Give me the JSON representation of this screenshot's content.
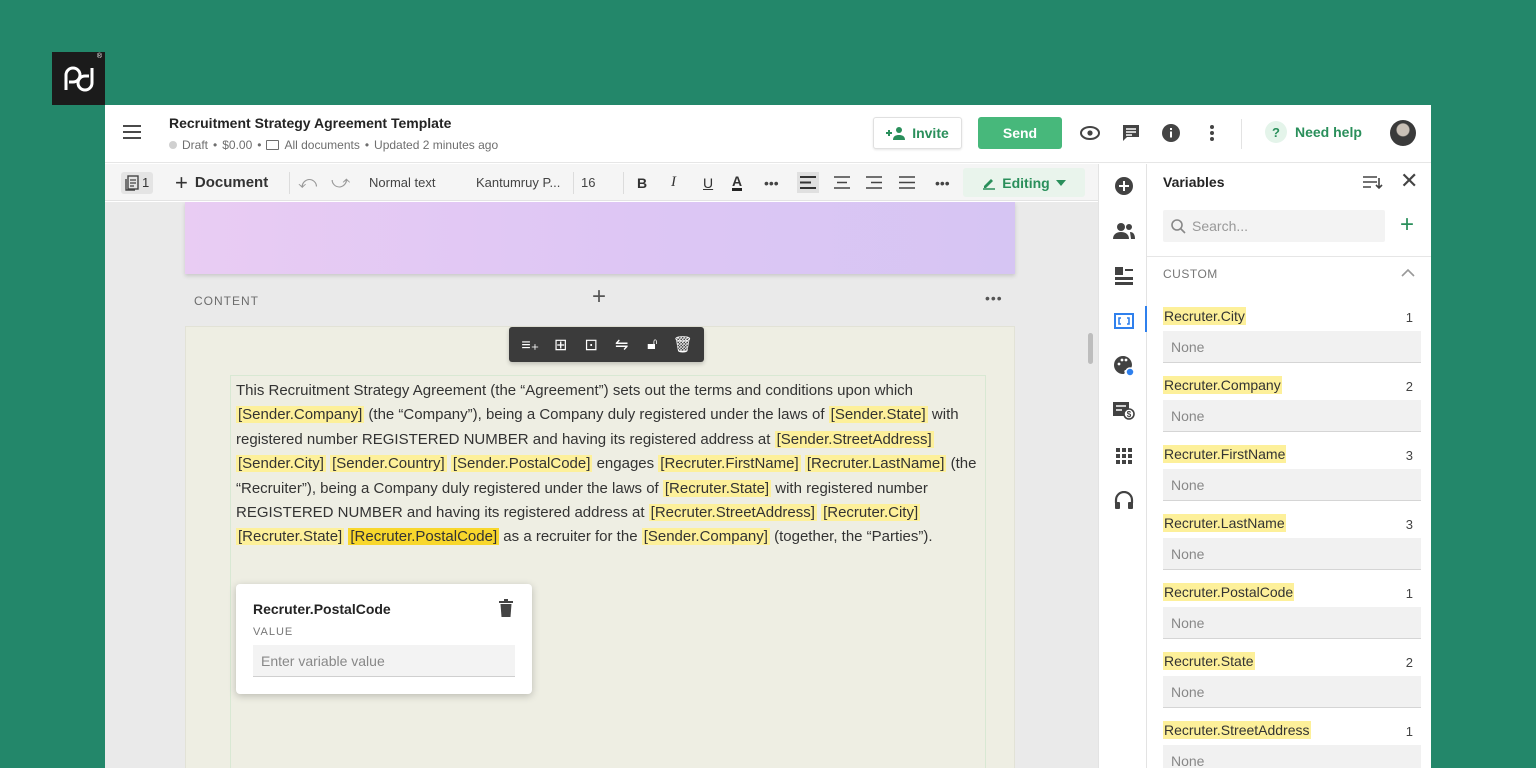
{
  "document": {
    "title": "Recruitment Strategy Agreement Template",
    "status": "Draft",
    "price": "$0.00",
    "folder": "All documents",
    "updated": "Updated 2 minutes ago"
  },
  "header": {
    "invite_label": "Invite",
    "send_label": "Send",
    "help_label": "Need help"
  },
  "toolbar": {
    "pages_count": "1",
    "add_document_label": "Document",
    "text_style": "Normal text",
    "font_name": "Kantumruy P...",
    "font_size": "16",
    "editing_label": "Editing"
  },
  "content": {
    "section_label": "CONTENT",
    "paragraph": [
      {
        "t": "This Recruitment Strategy Agreement (the “Agreement”) sets out the terms and conditions upon which ",
        "v": false
      },
      {
        "t": "[Sender.Company]",
        "v": true
      },
      {
        "t": " (the “Company”), being a Company duly registered under the laws of ",
        "v": false
      },
      {
        "t": "[Sender.State]",
        "v": true
      },
      {
        "t": " with registered number REGISTERED NUMBER and having its registered address at ",
        "v": false
      },
      {
        "t": "[Sender.StreetAddress]",
        "v": true
      },
      {
        "t": " ",
        "v": false
      },
      {
        "t": "[Sender.City]",
        "v": true
      },
      {
        "t": " ",
        "v": false
      },
      {
        "t": "[Sender.Country]",
        "v": true
      },
      {
        "t": " ",
        "v": false
      },
      {
        "t": "[Sender.PostalCode]",
        "v": true
      },
      {
        "t": " engages ",
        "v": false
      },
      {
        "t": "[Recruter.FirstName]",
        "v": true
      },
      {
        "t": " ",
        "v": false
      },
      {
        "t": "[Recruter.LastName]",
        "v": true
      },
      {
        "t": " (the “Recruiter”), being a Company duly registered under the laws of ",
        "v": false
      },
      {
        "t": "[Recruter.State]",
        "v": true
      },
      {
        "t": " with registered number REGISTERED NUMBER and having its registered address at ",
        "v": false
      },
      {
        "t": "[Recruter.StreetAddress]",
        "v": true
      },
      {
        "t": " ",
        "v": false
      },
      {
        "t": "[Recruter.City]",
        "v": true
      },
      {
        "t": " ",
        "v": false
      },
      {
        "t": "[Recruter.State]",
        "v": true
      },
      {
        "t": " ",
        "v": false
      },
      {
        "t": "[Recruter.PostalCode]",
        "v": true,
        "active": true
      },
      {
        "t": "  as a recruiter for the ",
        "v": false
      },
      {
        "t": "[Sender.Company]",
        "v": true
      },
      {
        "t": " (together, the “Parties”).",
        "v": false
      }
    ]
  },
  "popup": {
    "title": "Recruter.PostalCode",
    "value_label": "VALUE",
    "placeholder": "Enter variable value"
  },
  "panel": {
    "title": "Variables",
    "search_placeholder": "Search...",
    "section_label": "CUSTOM",
    "variables": [
      {
        "name": "Recruter.City",
        "count": "1",
        "value": "None"
      },
      {
        "name": "Recruter.Company",
        "count": "2",
        "value": "None"
      },
      {
        "name": "Recruter.FirstName",
        "count": "3",
        "value": "None"
      },
      {
        "name": "Recruter.LastName",
        "count": "3",
        "value": "None"
      },
      {
        "name": "Recruter.PostalCode",
        "count": "1",
        "value": "None"
      },
      {
        "name": "Recruter.State",
        "count": "2",
        "value": "None"
      },
      {
        "name": "Recruter.StreetAddress",
        "count": "1",
        "value": "None"
      }
    ]
  },
  "colors": {
    "background": "#23876a",
    "accent_green": "#47b87b",
    "variable_highlight": "#fdf09a",
    "variable_active": "#f8d72c"
  },
  "icons": {
    "logo": "pandadoc-logo",
    "rail": [
      "add-circle-icon",
      "recipients-icon",
      "blocks-icon",
      "variables-icon",
      "palette-icon",
      "payment-icon",
      "apps-icon",
      "support-headset-icon"
    ]
  }
}
